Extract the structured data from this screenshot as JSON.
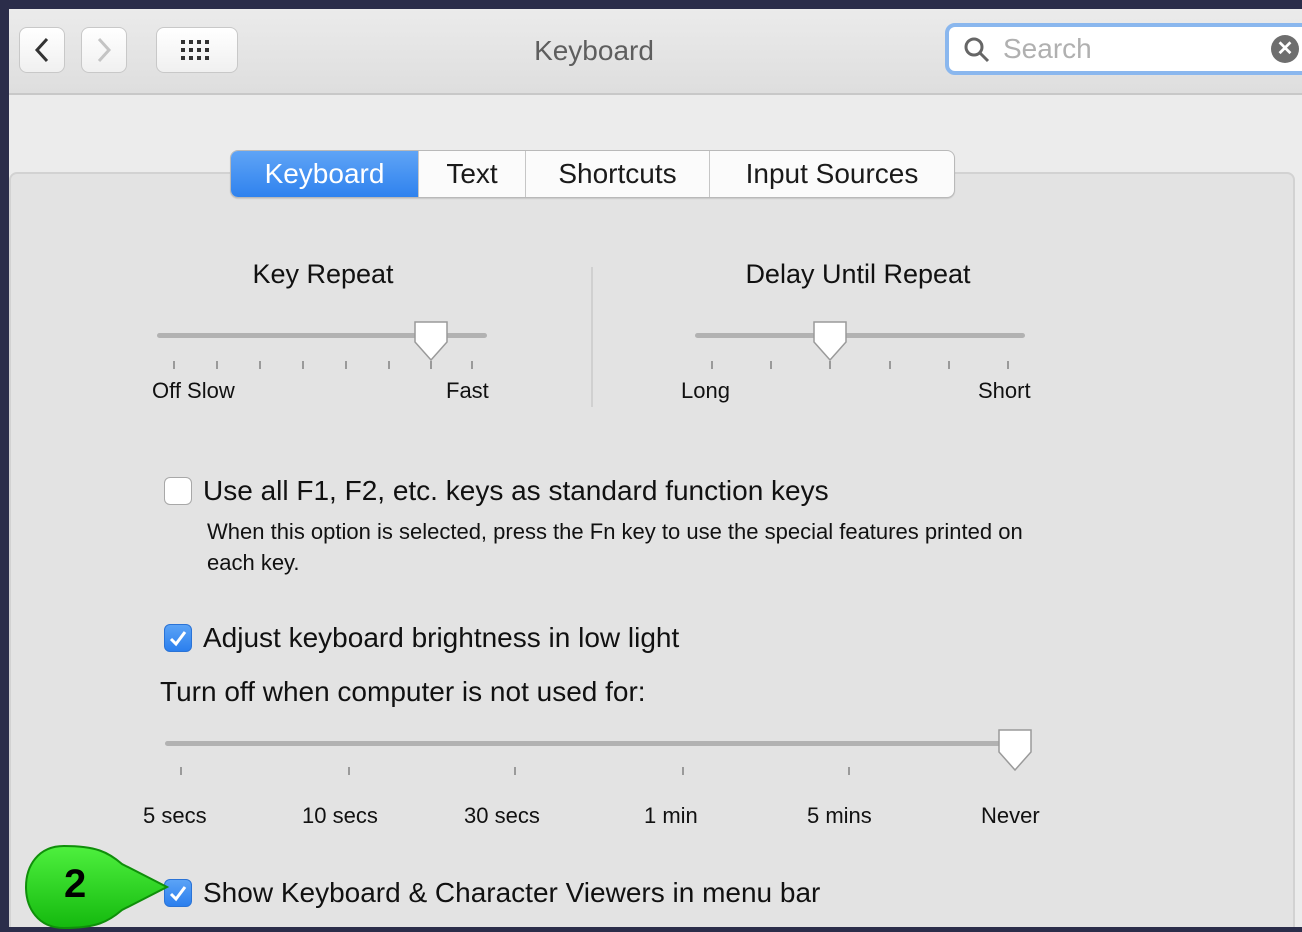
{
  "window": {
    "title": "Keyboard"
  },
  "toolbar": {
    "back_icon": "chevron-left-icon",
    "forward_icon": "chevron-right-icon",
    "grid_icon": "grid-icon"
  },
  "search": {
    "placeholder": "Search",
    "value": ""
  },
  "tabs": [
    {
      "label": "Keyboard",
      "active": true
    },
    {
      "label": "Text",
      "active": false
    },
    {
      "label": "Shortcuts",
      "active": false
    },
    {
      "label": "Input Sources",
      "active": false
    }
  ],
  "key_repeat": {
    "title": "Key Repeat",
    "left_label": "Off Slow",
    "right_label": "Fast",
    "ticks": 8,
    "selected_index": 6
  },
  "delay_until_repeat": {
    "title": "Delay Until Repeat",
    "left_label": "Long",
    "right_label": "Short",
    "ticks": 6,
    "selected_index": 2
  },
  "function_keys": {
    "label": "Use all F1, F2, etc. keys as standard function keys",
    "checked": false,
    "description": "When this option is selected, press the Fn key to use the special features printed on each key."
  },
  "brightness": {
    "label": "Adjust keyboard brightness in low light",
    "checked": true
  },
  "turn_off": {
    "label": "Turn off when computer is not used for:",
    "options": [
      "5 secs",
      "10 secs",
      "30 secs",
      "1 min",
      "5 mins",
      "Never"
    ],
    "selected_index": 5
  },
  "viewers": {
    "label": "Show Keyboard & Character Viewers in menu bar",
    "checked": true
  },
  "callout": {
    "number": "2",
    "color": "#22d21a"
  },
  "colors": {
    "accent": "#2f82ee",
    "search_ring": "#8ab7ee",
    "background": "#2b2d4a"
  }
}
